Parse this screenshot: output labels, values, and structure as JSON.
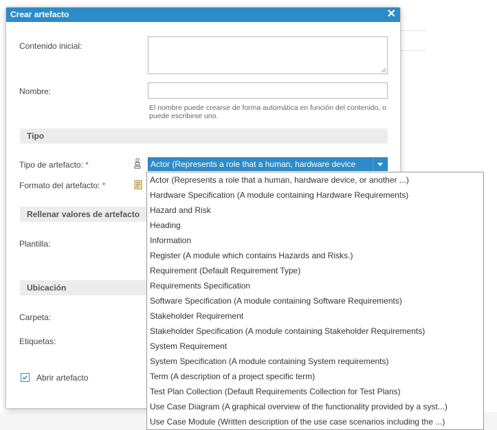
{
  "dialog": {
    "title": "Crear artefacto",
    "close_symbol": "✕"
  },
  "form": {
    "initial_content_label": "Contenido inicial:",
    "name_label": "Nombre:",
    "name_hint": "El nombre puede crearse de forma automática en función del contenido, o puede escribirse uno.",
    "type_section": "Tipo",
    "artifact_type_label": "Tipo de artefacto:",
    "artifact_format_label": "Formato del artefacto:",
    "required_marker": "*",
    "artifact_type_selected": "Actor (Represents a role that a human, hardware device",
    "fill_values_section": "Rellenar valores de artefacto",
    "template_label": "Plantilla:",
    "location_section": "Ubicación",
    "folder_label": "Carpeta:",
    "tags_label": "Etiquetas:",
    "open_artifact_label": "Abrir artefacto",
    "open_artifact_checked": true
  },
  "dropdown": {
    "options": [
      "Actor (Represents a role that a human, hardware device, or another ...)",
      "Hardware Specification (A module containing Hardware Requirements)",
      "Hazard and Risk",
      "Heading",
      "Information",
      "Register (A module which contains Hazards and Risks.)",
      "Requirement (Default Requirement Type)",
      "Requirements Specification",
      "Software Specification (A module containing Software Requirements)",
      "Stakeholder Requirement",
      "Stakeholder Specification (A module containing Stakeholder Requirements)",
      "System Requirement",
      "System Specification (A module containing System requirements)",
      "Term (A description of a project specific term)",
      "Test Plan Collection (Default Requirements Collection for Test Plans)",
      "Use Case Diagram (A graphical overview of the functionality provided by a syst...)",
      "Use Case Module (Written description of the use case scenarios including the ...)"
    ]
  },
  "icons": {
    "type_icon": "person-hierarchy-icon",
    "format_icon": "document-icon",
    "dropdown_arrow": "chevron-down-icon"
  },
  "colors": {
    "accent": "#2d8bc7",
    "required": "#d23a3a"
  }
}
